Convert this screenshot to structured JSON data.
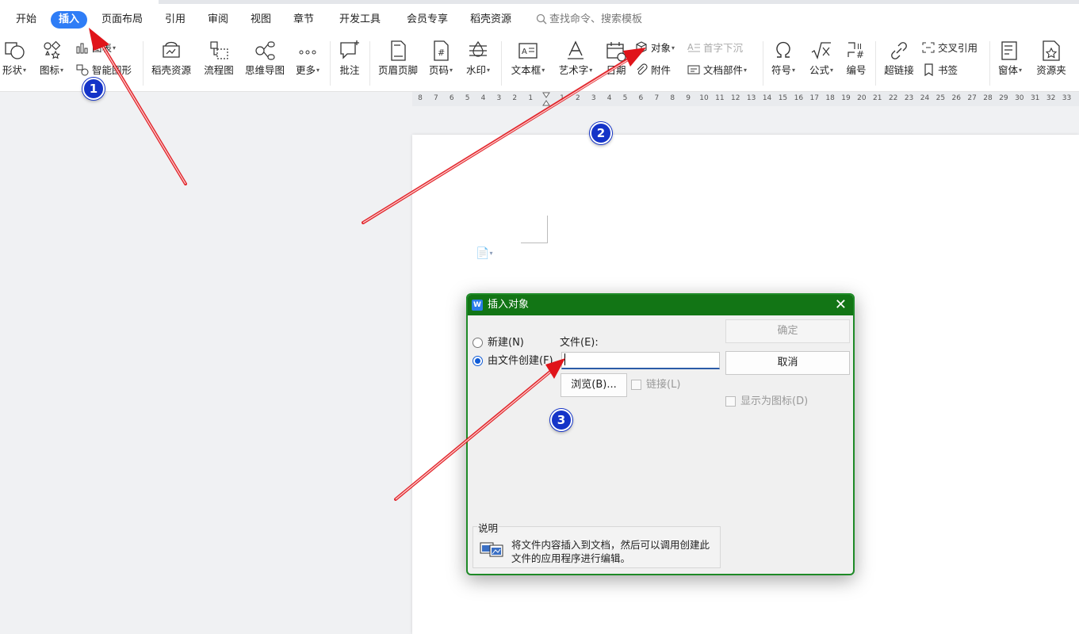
{
  "menu_tabs": [
    "开始",
    "插入",
    "页面布局",
    "引用",
    "审阅",
    "视图",
    "章节",
    "开发工具",
    "会员专享",
    "稻壳资源"
  ],
  "search": {
    "text": "查找命令、搜索模板"
  },
  "ribbon": {
    "shape": "形状",
    "icon": "图标",
    "chart": "图表",
    "smart_shape": "智能图形",
    "docer_resource": "稻壳资源",
    "flowchart": "流程图",
    "mindmap": "思维导图",
    "more": "更多",
    "comment": "批注",
    "header_footer": "页眉页脚",
    "page_number": "页码",
    "watermark": "水印",
    "textbox": "文本框",
    "wordart": "艺术字",
    "date": "日期",
    "object": "对象",
    "attachment": "附件",
    "drop_cap": "首字下沉",
    "doc_parts": "文档部件",
    "symbol": "符号",
    "formula": "公式",
    "numbering": "编号",
    "hyperlink": "超链接",
    "cross_ref": "交叉引用",
    "bookmark": "书签",
    "form": "窗体",
    "resource_folder": "资源夹"
  },
  "ruler_numbers": [
    "8",
    "7",
    "6",
    "5",
    "4",
    "3",
    "2",
    "1",
    "",
    "1",
    "2",
    "3",
    "4",
    "5",
    "6",
    "7",
    "8",
    "9",
    "10",
    "11",
    "12",
    "13",
    "14",
    "15",
    "16",
    "17",
    "18",
    "19",
    "20",
    "21",
    "22",
    "23",
    "24",
    "25",
    "26",
    "27",
    "28",
    "29",
    "30",
    "31",
    "32",
    "33"
  ],
  "dialog": {
    "title": "插入对象",
    "new_option": "新建(N)",
    "from_file_option": "由文件创建(F)",
    "file_label": "文件(E):",
    "file_value": "",
    "ok": "确定",
    "cancel": "取消",
    "browse": "浏览(B)...",
    "link": "链接(L)",
    "display_as_icon": "显示为图标(D)",
    "description_title": "说明",
    "description_text": "将文件内容插入到文档，然后可以调用创建此文件的应用程序进行编辑。"
  },
  "annotations": [
    "1",
    "2",
    "3"
  ],
  "colors": {
    "accent": "#2f7df6",
    "dialog_title": "#127515",
    "arrow": "#e0141a",
    "badge": "#1534c8"
  }
}
